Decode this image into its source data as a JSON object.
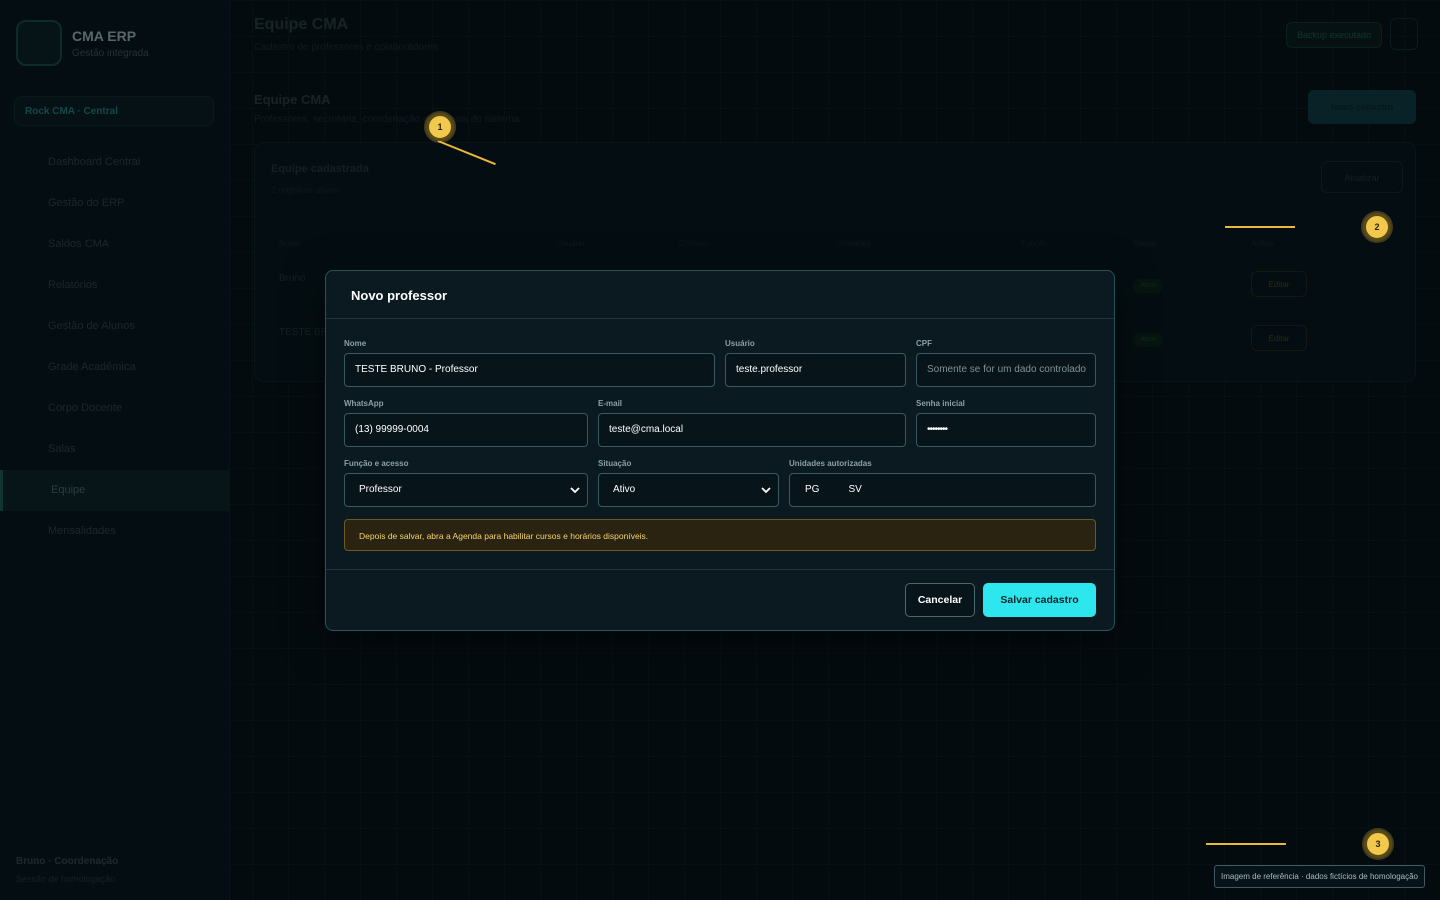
{
  "app": {
    "brand_name": "CMA ERP",
    "brand_sub": "Gestão integrada"
  },
  "sidebar": {
    "unit_selector": "Rock CMA · Central",
    "items": [
      {
        "label": "Dashboard Central"
      },
      {
        "label": "Gestão do ERP"
      },
      {
        "label": "Saldos CMA"
      },
      {
        "label": "Relatórios"
      },
      {
        "label": "Gestão de Alunos"
      },
      {
        "label": "Grade Acadêmica"
      },
      {
        "label": "Corpo Docente"
      },
      {
        "label": "Salas"
      },
      {
        "label": "Equipe"
      },
      {
        "label": "Mensalidades"
      }
    ],
    "user_name": "Bruno · Coordenação",
    "user_sub": "Sessão de homologação"
  },
  "page": {
    "title": "Equipe CMA",
    "subtitle": "Cadastro de professores e colaboradores",
    "top_button": "Backup executado",
    "section_title": "Equipe CMA",
    "section_sub": "Professores, secretaria, coordenação e acessos do sistema",
    "new_button": "Novo cadastro",
    "card_title": "Equipe cadastrada",
    "card_sub": "2 registros ativos",
    "card_button": "Atualizar",
    "table_headers": [
      "Nome",
      "Usuário",
      "Contato",
      "Unidades",
      "Função",
      "Status",
      "Ações"
    ],
    "rows": [
      {
        "name": "Bruno",
        "status": "Ativo",
        "action": "Editar"
      },
      {
        "name": "TESTE BRU",
        "status": "Ativo",
        "action": "Editar"
      }
    ]
  },
  "modal": {
    "title": "Novo professor",
    "fields": {
      "nome": {
        "label": "Nome",
        "value": "TESTE BRUNO - Professor"
      },
      "usuario": {
        "label": "Usuário",
        "value": "teste.professor"
      },
      "cpf": {
        "label": "CPF",
        "placeholder": "Somente se for um dado controlado"
      },
      "whatsapp": {
        "label": "WhatsApp",
        "value": "(13) 99999-0004"
      },
      "email": {
        "label": "E-mail",
        "value": "teste@cma.local"
      },
      "senha": {
        "label": "Senha inicial",
        "value": "••••••••"
      },
      "funcao": {
        "label": "Função e acesso",
        "value": "Professor"
      },
      "situacao": {
        "label": "Situação",
        "value": "Ativo"
      },
      "unidades": {
        "label": "Unidades autorizadas",
        "values": [
          "PG",
          "SV"
        ]
      }
    },
    "notice": "Depois de salvar, abra a Agenda para habilitar cursos e horários disponíveis.",
    "cancel_label": "Cancelar",
    "save_label": "Salvar cadastro"
  },
  "markers": [
    "1",
    "2",
    "3"
  ],
  "reference_badge": "Imagem de referência · dados fictícios de homologação",
  "colors": {
    "accent": "#2ee6ee",
    "marker": "#f2c94c",
    "notice_bg": "#2a2311",
    "notice_text": "#f5d36a"
  }
}
